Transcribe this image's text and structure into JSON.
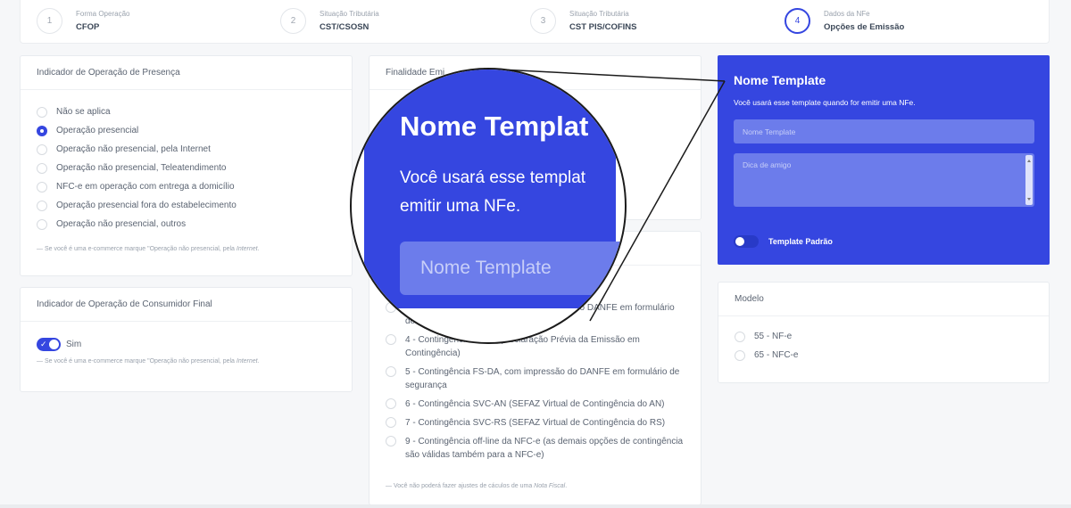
{
  "stepper": {
    "steps": [
      {
        "num": "1",
        "label": "Forma Operação",
        "value": "CFOP",
        "active": false
      },
      {
        "num": "2",
        "label": "Situação Tributária",
        "value": "CST/CSOSN",
        "active": false
      },
      {
        "num": "3",
        "label": "Situação Tributária",
        "value": "CST PIS/COFINS",
        "active": false
      },
      {
        "num": "4",
        "label": "Dados da NFe",
        "value": "Opções de Emissão",
        "active": true
      }
    ]
  },
  "presenca": {
    "title": "Indicador de Operação de Presença",
    "options": [
      {
        "label": "Não se aplica",
        "selected": false
      },
      {
        "label": "Operação presencial",
        "selected": true
      },
      {
        "label": "Operação não presencial, pela Internet",
        "selected": false
      },
      {
        "label": "Operação não presencial, Teleatendimento",
        "selected": false
      },
      {
        "label": "NFC-e em operação com entrega a domicílio",
        "selected": false
      },
      {
        "label": "Operação presencial fora do estabelecimento",
        "selected": false
      },
      {
        "label": "Operação não presencial, outros",
        "selected": false
      }
    ],
    "note_prefix": "— Se você é uma e-commerce marque \"Operação não presencial, pela ",
    "note_italic": "Internet",
    "note_suffix": "."
  },
  "consumidor": {
    "title": "Indicador de Operação de Consumidor Final",
    "toggle_label": "Sim",
    "toggle_on": true,
    "note_prefix": "— Se você é uma e-commerce marque \"Operação não presencial, pela ",
    "note_italic": "Internet",
    "note_suffix": "."
  },
  "finalidade": {
    "title": "Finalidade Emi"
  },
  "contingencia": {
    "options": [
      {
        "label": "3 - Contingência SCAN, com impressão do DANFE em formulário de segurança"
      },
      {
        "label": "4 - Contingência DPEC (Declaração Prévia da Emissão em Contingência)"
      },
      {
        "label": "5 - Contingência FS-DA, com impressão do DANFE em formulário de segurança"
      },
      {
        "label": "6 - Contingência SVC-AN (SEFAZ Virtual de Contingência do AN)"
      },
      {
        "label": "7 - Contingência SVC-RS (SEFAZ Virtual de Contingência do RS)"
      },
      {
        "label": "9 - Contingência off-line da NFC-e (as demais opções de contingência são válidas também para a NFC-e)"
      }
    ],
    "visible_first": "do DANFE em formulário",
    "visible_first_tail": "de s",
    "note_prefix": "— Você não poderá fazer ajustes de cáculos de uma ",
    "note_italic": "Nota Fiscal",
    "note_suffix": "."
  },
  "template": {
    "title": "Nome Template",
    "subtitle": "Você usará esse template quando for emitir uma NFe.",
    "name_placeholder": "Nome Template",
    "hint_placeholder": "Dica de amigo",
    "default_label": "Template Padrão",
    "default_on": false
  },
  "zoom": {
    "title": "Nome Templat",
    "line1": "Você usará esse templat",
    "line2": "emitir uma NFe.",
    "input": "Nome Template"
  },
  "modelo": {
    "title": "Modelo",
    "options": [
      {
        "label": "55 - NF-e",
        "selected": false
      },
      {
        "label": "65 - NFC-e",
        "selected": false
      }
    ]
  },
  "colors": {
    "accent": "#3546e0",
    "input_fill": "#6c7ceb"
  }
}
